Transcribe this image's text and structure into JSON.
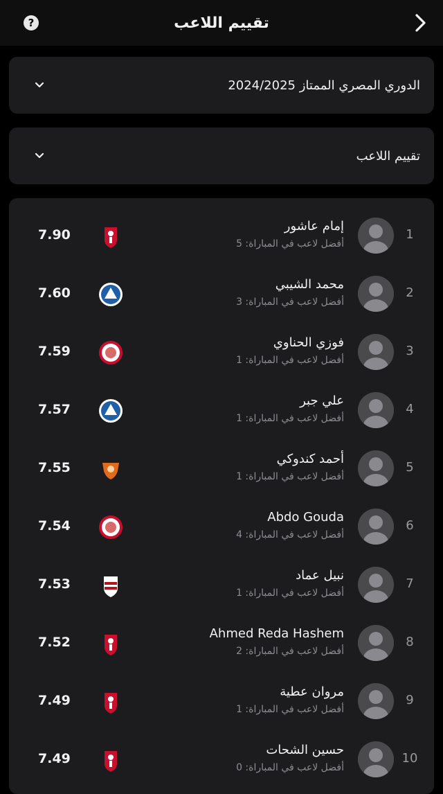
{
  "header": {
    "title": "تقييم اللاعب",
    "help_label": "?"
  },
  "filters": {
    "league": "الدوري المصري الممتاز 2024/2025",
    "stat": "تقييم اللاعب"
  },
  "colors": {
    "background": "#000000",
    "card": "#1c1c1e",
    "secondary_text": "#8e8e93",
    "ahly_red": "#c8102e",
    "pyramids_blue": "#1f5fa8",
    "zamalek_red": "#b0161e",
    "sun_orange": "#e06a1d"
  },
  "players": [
    {
      "rank": "1",
      "name": "إمام عاشور",
      "mom": "أفضل لاعب في المباراة: 5",
      "rating": "7.90",
      "club_icon": "ahly-crest-icon"
    },
    {
      "rank": "2",
      "name": "محمد الشيبي",
      "mom": "أفضل لاعب في المباراة: 3",
      "rating": "7.60",
      "club_icon": "pyramids-crest-icon"
    },
    {
      "rank": "3",
      "name": "فوزي الحناوي",
      "mom": "أفضل لاعب في المباراة: 1",
      "rating": "7.59",
      "club_icon": "round-red-crest-icon"
    },
    {
      "rank": "4",
      "name": "علي جبر",
      "mom": "أفضل لاعب في المباراة: 1",
      "rating": "7.57",
      "club_icon": "pyramids-crest-icon"
    },
    {
      "rank": "5",
      "name": "أحمد كندوكي",
      "mom": "أفضل لاعب في المباراة: 1",
      "rating": "7.55",
      "club_icon": "orange-shield-crest-icon"
    },
    {
      "rank": "6",
      "name": "Abdo Gouda",
      "mom": "أفضل لاعب في المباراة: 4",
      "rating": "7.54",
      "club_icon": "round-red-crest-icon"
    },
    {
      "rank": "7",
      "name": "نبيل عماد",
      "mom": "أفضل لاعب في المباراة: 1",
      "rating": "7.53",
      "club_icon": "zamalek-crest-icon"
    },
    {
      "rank": "8",
      "name": "Ahmed Reda Hashem",
      "mom": "أفضل لاعب في المباراة: 2",
      "rating": "7.52",
      "club_icon": "ahly-crest-icon"
    },
    {
      "rank": "9",
      "name": "مروان عطية",
      "mom": "أفضل لاعب في المباراة: 1",
      "rating": "7.49",
      "club_icon": "ahly-crest-icon"
    },
    {
      "rank": "10",
      "name": "حسين الشحات",
      "mom": "أفضل لاعب في المباراة: 0",
      "rating": "7.49",
      "club_icon": "ahly-crest-icon"
    }
  ]
}
